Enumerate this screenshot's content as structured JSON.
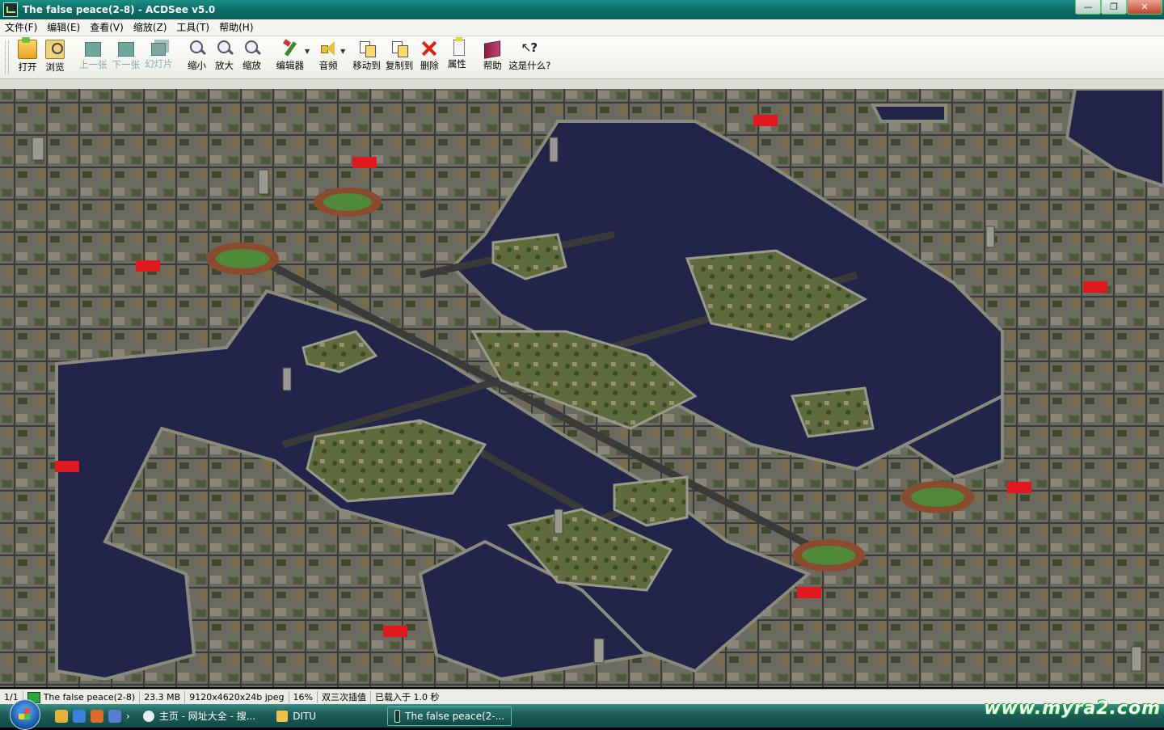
{
  "window": {
    "title": "The false peace(2-8) - ACDSee v5.0"
  },
  "menu": [
    "文件(F)",
    "编辑(E)",
    "查看(V)",
    "缩放(Z)",
    "工具(T)",
    "帮助(H)"
  ],
  "toolbar": {
    "open": "打开",
    "browse": "浏览",
    "prev": "上一张",
    "next": "下一张",
    "slideshow": "幻灯片",
    "zoom_out": "缩小",
    "zoom_in": "放大",
    "zoom": "缩放",
    "editor": "编辑器",
    "audio": "音频",
    "move_to": "移动到",
    "copy_to": "复制到",
    "delete": "删除",
    "properties": "属性",
    "help": "帮助",
    "whats_this": "这是什么?"
  },
  "status": {
    "index": "1/1",
    "filename": "The false peace(2-8)",
    "size": "23.3 MB",
    "dims": "9120x4620x24b jpeg",
    "zoom": "16%",
    "interp": "双三次插值",
    "loaded": "已载入于 1.0 秒"
  },
  "taskbar": {
    "tasks": [
      "主页 - 网址大全 - 搜...",
      "DITU",
      "The false peace(2-..."
    ]
  },
  "watermark": "www.myra2.com",
  "colors": {
    "titlebar": "#0c6b64",
    "water": "#1f2145",
    "land": "#6b6b62",
    "taskbar": "#1c5f58"
  }
}
